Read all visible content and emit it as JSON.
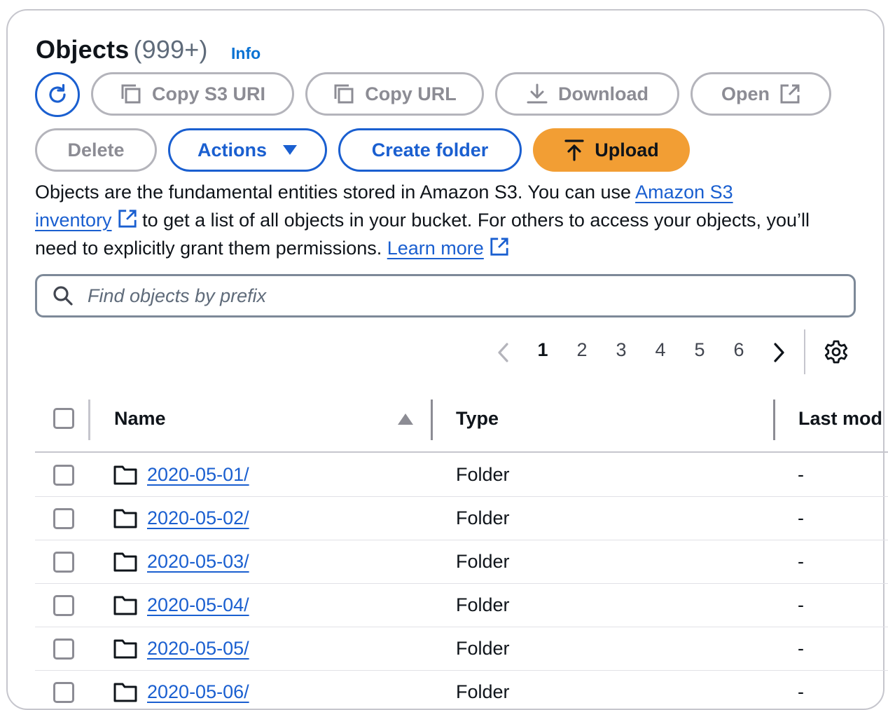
{
  "header": {
    "title": "Objects",
    "count": "(999+)",
    "info": "Info"
  },
  "toolbar": {
    "copy_s3_uri": "Copy S3 URI",
    "copy_url": "Copy URL",
    "download": "Download",
    "open": "Open",
    "delete": "Delete",
    "actions": "Actions",
    "create_folder": "Create folder",
    "upload": "Upload"
  },
  "description": {
    "part1": "Objects are the fundamental entities stored in Amazon S3. You can use ",
    "link1": "Amazon S3 inventory",
    "part2": " to get a list of all objects in your bucket. For others to access your objects, you’ll need to explicitly grant them permissions. ",
    "link2": "Learn more"
  },
  "search": {
    "placeholder": "Find objects by prefix"
  },
  "pagination": {
    "pages": [
      "1",
      "2",
      "3",
      "4",
      "5",
      "6"
    ],
    "current": "1"
  },
  "table": {
    "columns": [
      "Name",
      "Type",
      "Last mod"
    ],
    "rows": [
      {
        "name": "2020-05-01/",
        "type": "Folder",
        "last_modified": "-"
      },
      {
        "name": "2020-05-02/",
        "type": "Folder",
        "last_modified": "-"
      },
      {
        "name": "2020-05-03/",
        "type": "Folder",
        "last_modified": "-"
      },
      {
        "name": "2020-05-04/",
        "type": "Folder",
        "last_modified": "-"
      },
      {
        "name": "2020-05-05/",
        "type": "Folder",
        "last_modified": "-"
      },
      {
        "name": "2020-05-06/",
        "type": "Folder",
        "last_modified": "-"
      }
    ]
  },
  "colors": {
    "link": "#1a5fd0",
    "upload_bg": "#f29e34",
    "disabled": "#8c8c94",
    "border": "#c6c6cd"
  }
}
